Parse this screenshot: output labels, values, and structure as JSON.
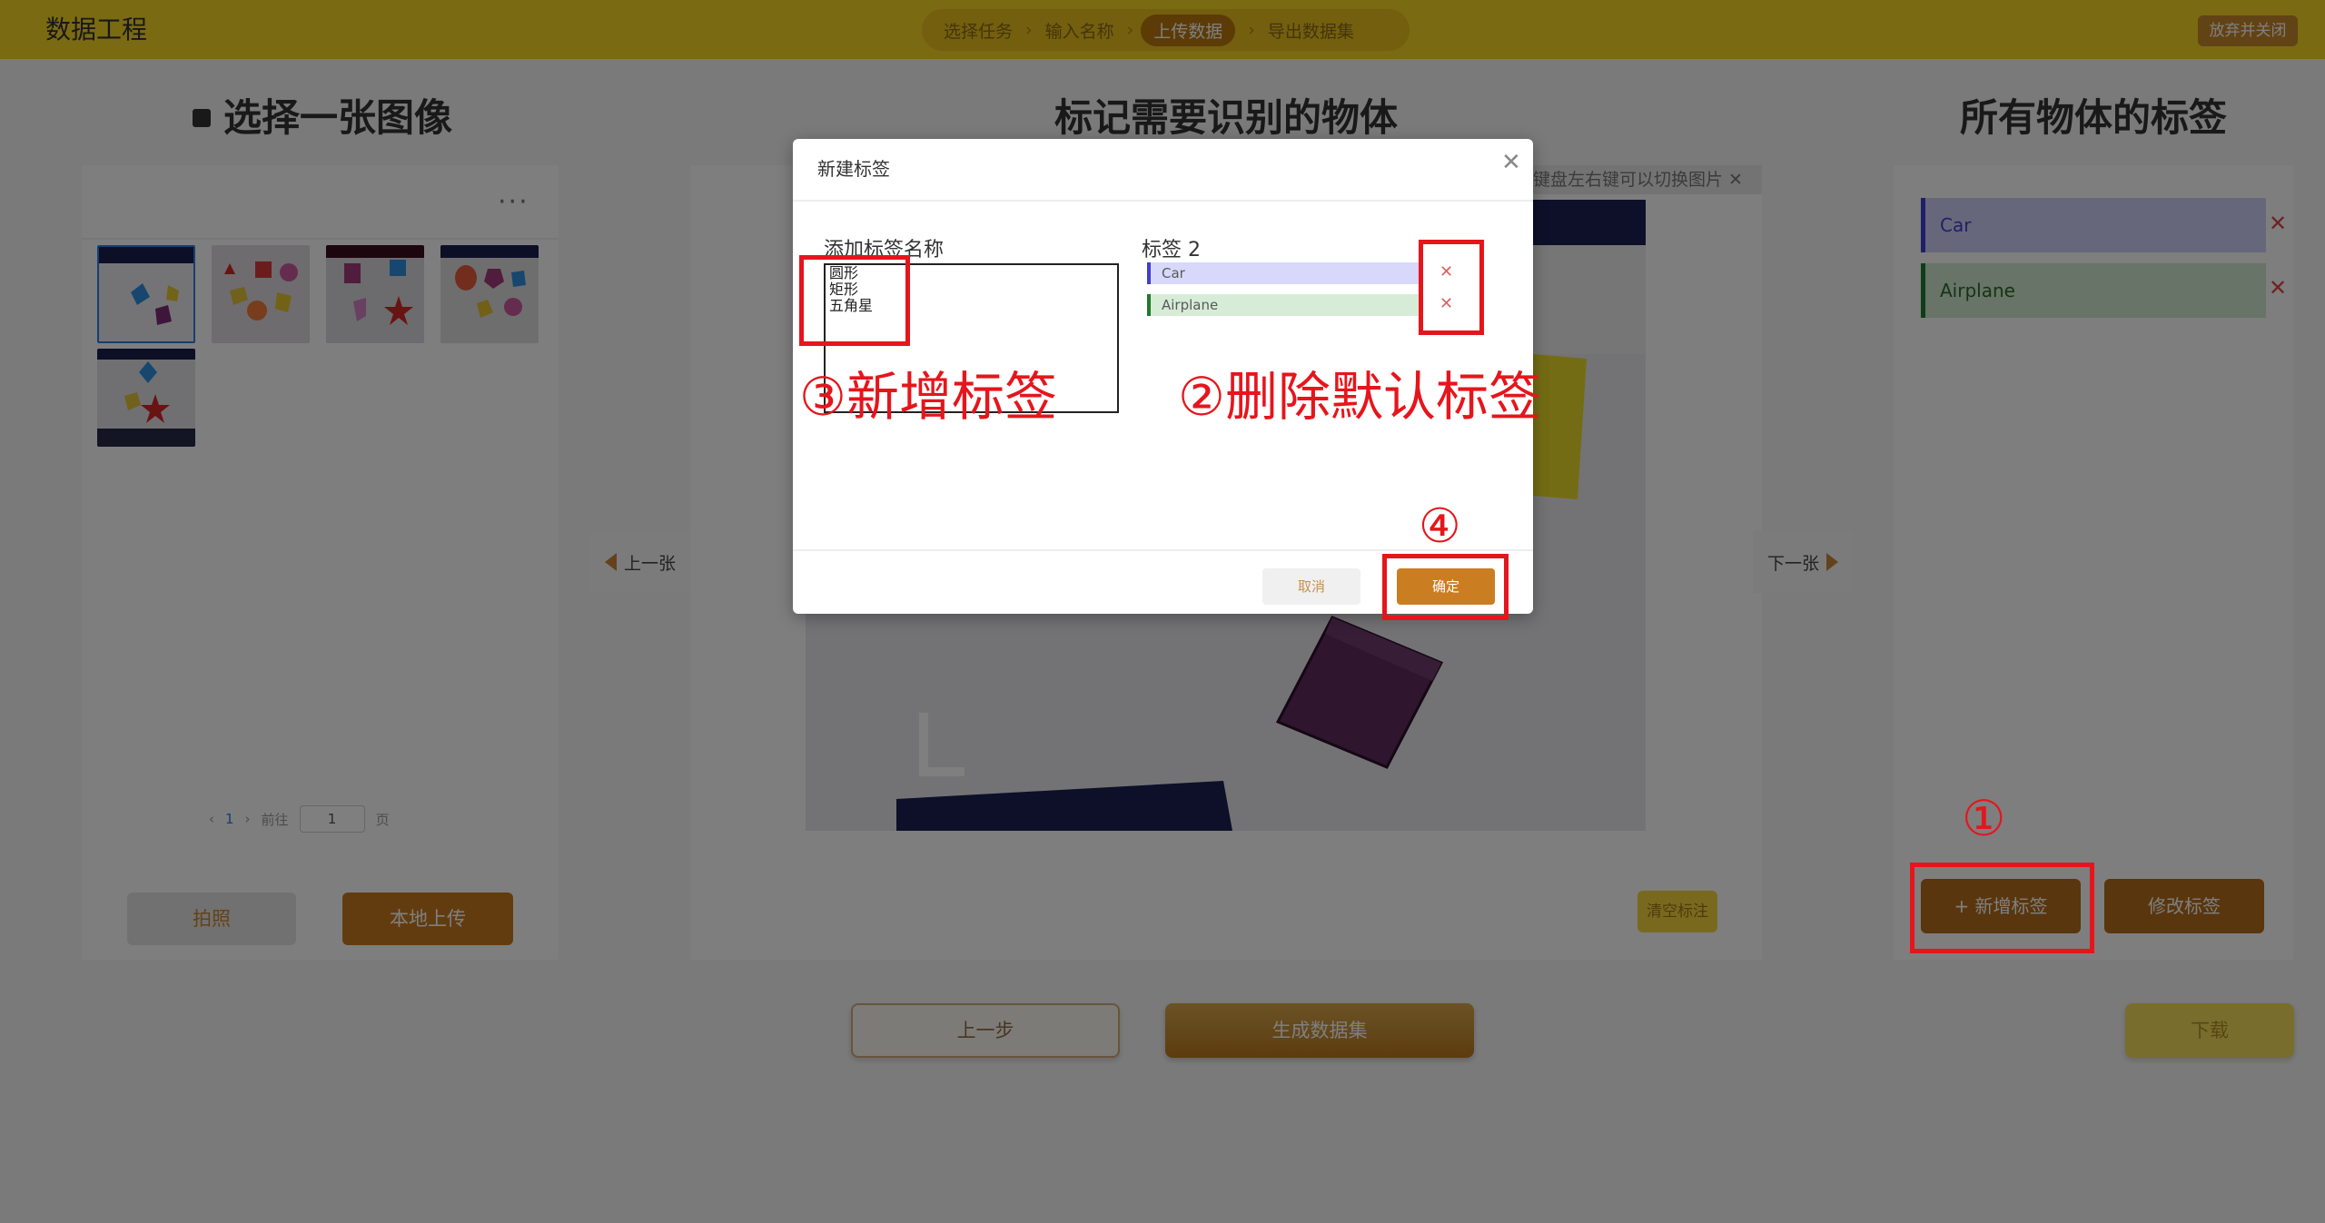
{
  "header": {
    "app_title": "数据工程",
    "steps": [
      "选择任务",
      "输入名称",
      "上传数据",
      "导出数据集"
    ],
    "active_step": "上传数据",
    "close_button": "放弃并关闭"
  },
  "left_panel": {
    "title": "选择一张图像",
    "pager": {
      "prev": "‹",
      "page": "1",
      "next": "›",
      "goto_label": "前往",
      "goto_value": "1",
      "page_unit": "页"
    },
    "camera_button": "拍照",
    "upload_button": "本地上传"
  },
  "center_panel": {
    "title": "标记需要识别的物体",
    "hint": "键盘左右键可以切换图片 ✕",
    "prev_image": "上一张",
    "next_image": "下一张",
    "clear_button": "清空标注"
  },
  "right_panel": {
    "title": "所有物体的标签",
    "tags": [
      {
        "name": "Car",
        "color": "#8e8ee8"
      },
      {
        "name": "Airplane",
        "color": "#2e8b3a"
      }
    ],
    "add_button": "+ 新增标签",
    "edit_button": "修改标签"
  },
  "bottom": {
    "prev_step": "上一步",
    "generate": "生成数据集",
    "download": "下载"
  },
  "modal": {
    "title": "新建标签",
    "add_label_heading": "添加标签名称",
    "textarea_value": "圆形\n矩形\n五角星",
    "labels_heading": "标签 2",
    "labels": [
      "Car",
      "Airplane"
    ],
    "cancel": "取消",
    "confirm": "确定"
  },
  "annotations": {
    "step1": "①",
    "step2": "②删除默认标签",
    "step3": "③新增标签",
    "step4": "④"
  }
}
